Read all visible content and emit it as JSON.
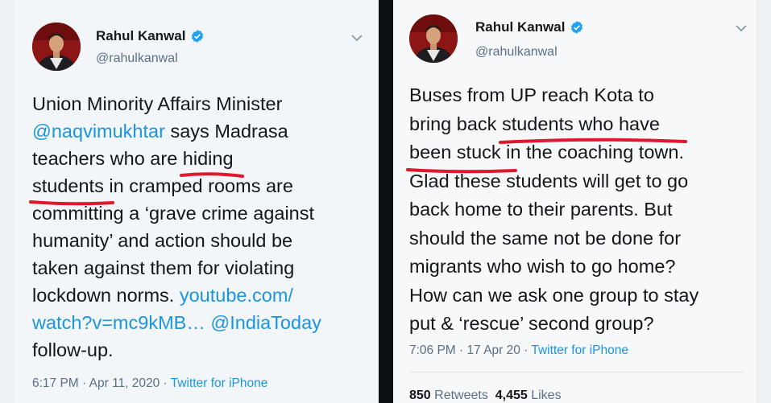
{
  "tweet1": {
    "name": "Rahul Kanwal",
    "handle": "@rahulkanwal",
    "lines": {
      "l1": "Union Minority Affairs Minister",
      "l2_link": "@naqvimukhtar",
      "l2_rest": " says Madrasa",
      "l3_pre": "teachers who are ",
      "l3_hl": "hiding",
      "l4_hl": "students",
      "l4_rest": " in cramped rooms are",
      "l5": "committing a ‘grave crime against",
      "l6": "humanity’ and action should be",
      "l7": "taken against them for violating",
      "l8_pre": "lockdown norms. ",
      "l8_link": "youtube.com/",
      "l9_link1": "watch?v=mc9kMB…",
      "l9_sp": " ",
      "l9_link2": "@IndiaToday",
      "l10": "follow-up."
    },
    "time": "6:17 PM · Apr 11, 2020 · ",
    "source": "Twitter for iPhone"
  },
  "tweet2": {
    "name": "Rahul Kanwal",
    "handle": "@rahulkanwal",
    "lines": {
      "l1": "Buses from UP reach Kota to",
      "l2_pre": "bring back ",
      "l2_hl": "students who have",
      "l3_hl": "been stuck",
      "l3_rest": " in the coaching town.",
      "l4": "Glad these students will get to go",
      "l5": "back home to their parents. But",
      "l6": "should the same not be done for",
      "l7": "migrants who wish to go home?",
      "l8": "How can we ask one group to stay",
      "l9": "put & ‘rescue’ second group?"
    },
    "time": "7:06 PM · 17 Apr 20 · ",
    "source": "Twitter for iPhone",
    "retweets_count": "850",
    "retweets_label": " Retweets",
    "likes_count": "4,455",
    "likes_label": " Likes"
  },
  "colors": {
    "link": "#1b95e0",
    "underline": "#e0182d",
    "verified": "#1da1f2"
  },
  "icons": {
    "verified": "verified-badge-icon",
    "chevron": "chevron-down-icon"
  }
}
